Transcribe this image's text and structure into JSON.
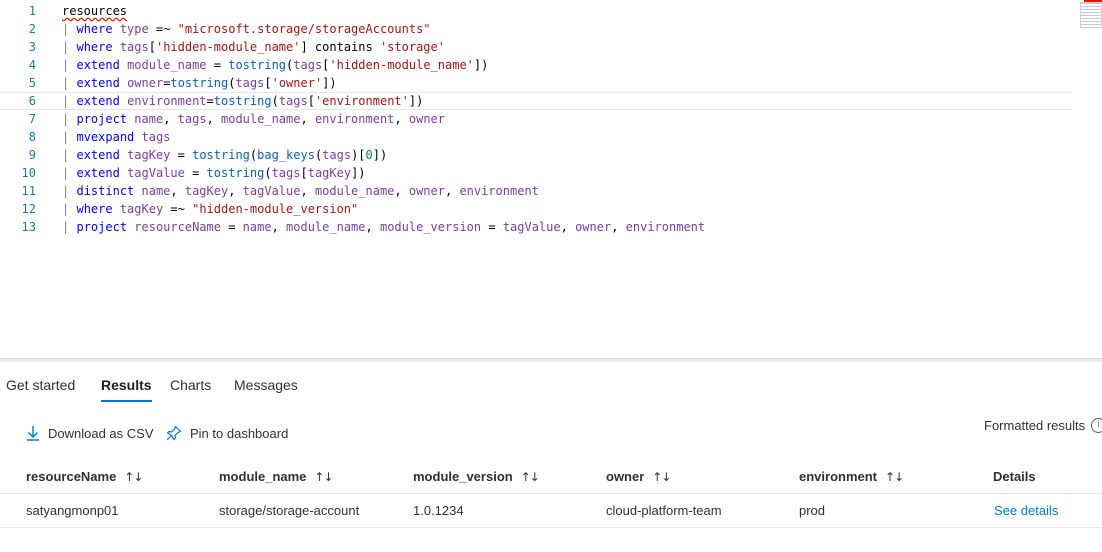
{
  "editor": {
    "lines": [
      {
        "n": "1",
        "text": "resources"
      },
      {
        "n": "2",
        "text": "| where type =~ \"microsoft.storage/storageAccounts\""
      },
      {
        "n": "3",
        "text": "| where tags['hidden-module_name'] contains 'storage'"
      },
      {
        "n": "4",
        "text": "| extend module_name = tostring(tags['hidden-module_name'])"
      },
      {
        "n": "5",
        "text": "| extend owner=tostring(tags['owner'])"
      },
      {
        "n": "6",
        "text": "| extend environment=tostring(tags['environment'])"
      },
      {
        "n": "7",
        "text": "| project name, tags, module_name, environment, owner"
      },
      {
        "n": "8",
        "text": "| mvexpand tags"
      },
      {
        "n": "9",
        "text": "| extend tagKey = tostring(bag_keys(tags)[0])"
      },
      {
        "n": "10",
        "text": "| extend tagValue = tostring(tags[tagKey])"
      },
      {
        "n": "11",
        "text": "| distinct name, tagKey, tagValue, module_name, owner, environment"
      },
      {
        "n": "12",
        "text": "| where tagKey =~ \"hidden-module_version\""
      },
      {
        "n": "13",
        "text": "| project resourceName = name, module_name, module_version = tagValue, owner, environment"
      }
    ]
  },
  "tabs": [
    "Get started",
    "Results",
    "Charts",
    "Messages"
  ],
  "active_tab": "Results",
  "toolbar": {
    "download_label": "Download as CSV",
    "pin_label": "Pin to dashboard",
    "formatted_label": "Formatted results",
    "info_glyph": "i"
  },
  "grid": {
    "columns": [
      "resourceName",
      "module_name",
      "module_version",
      "owner",
      "environment",
      "Details"
    ],
    "sort_glyph": "↑↓",
    "rows": [
      {
        "resourceName": "satyangmonp01",
        "module_name": "storage/storage-account",
        "module_version": "1.0.1234",
        "owner": "cloud-platform-team",
        "environment": "prod",
        "details": "See details"
      }
    ]
  },
  "colors": {
    "accent": "#0078d4",
    "error": "#e51400"
  }
}
